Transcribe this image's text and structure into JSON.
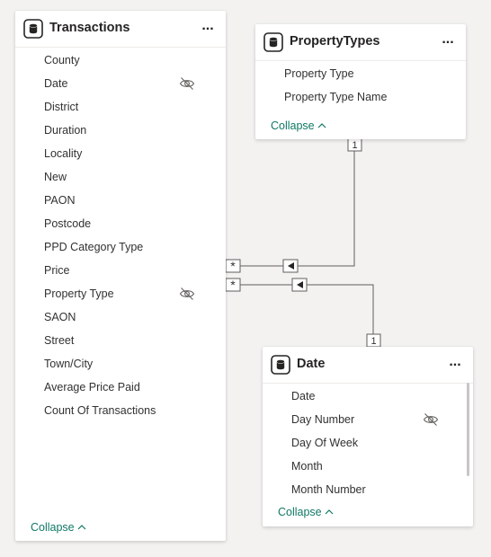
{
  "colors": {
    "canvas": "#f3f2f1",
    "card": "#ffffff",
    "text": "#323130",
    "link": "#117865",
    "relationship_line": "#605e5c"
  },
  "tables": {
    "transactions": {
      "title": "Transactions",
      "more_label": "...",
      "collapse_label": "Collapse",
      "fields": [
        {
          "name": "County",
          "hidden": false
        },
        {
          "name": "Date",
          "hidden": true
        },
        {
          "name": "District",
          "hidden": false
        },
        {
          "name": "Duration",
          "hidden": false
        },
        {
          "name": "Locality",
          "hidden": false
        },
        {
          "name": "New",
          "hidden": false
        },
        {
          "name": "PAON",
          "hidden": false
        },
        {
          "name": "Postcode",
          "hidden": false
        },
        {
          "name": "PPD Category Type",
          "hidden": false
        },
        {
          "name": "Price",
          "hidden": false
        },
        {
          "name": "Property Type",
          "hidden": true
        },
        {
          "name": "SAON",
          "hidden": false
        },
        {
          "name": "Street",
          "hidden": false
        },
        {
          "name": "Town/City",
          "hidden": false
        },
        {
          "name": "Average Price Paid",
          "hidden": false
        },
        {
          "name": "Count Of Transactions",
          "hidden": false
        }
      ]
    },
    "property_types": {
      "title": "PropertyTypes",
      "more_label": "...",
      "collapse_label": "Collapse",
      "fields": [
        {
          "name": "Property Type",
          "hidden": false
        },
        {
          "name": "Property Type Name",
          "hidden": false
        }
      ]
    },
    "date": {
      "title": "Date",
      "more_label": "...",
      "collapse_label": "Collapse",
      "fields": [
        {
          "name": "Date",
          "hidden": false
        },
        {
          "name": "Day Number",
          "hidden": true
        },
        {
          "name": "Day Of Week",
          "hidden": false
        },
        {
          "name": "Month",
          "hidden": false
        },
        {
          "name": "Month Number",
          "hidden": false
        }
      ]
    }
  },
  "relationships": [
    {
      "from": "Transactions",
      "to": "PropertyTypes",
      "many_label": "*",
      "one_label": "1"
    },
    {
      "from": "Transactions",
      "to": "Date",
      "many_label": "*",
      "one_label": "1"
    }
  ]
}
